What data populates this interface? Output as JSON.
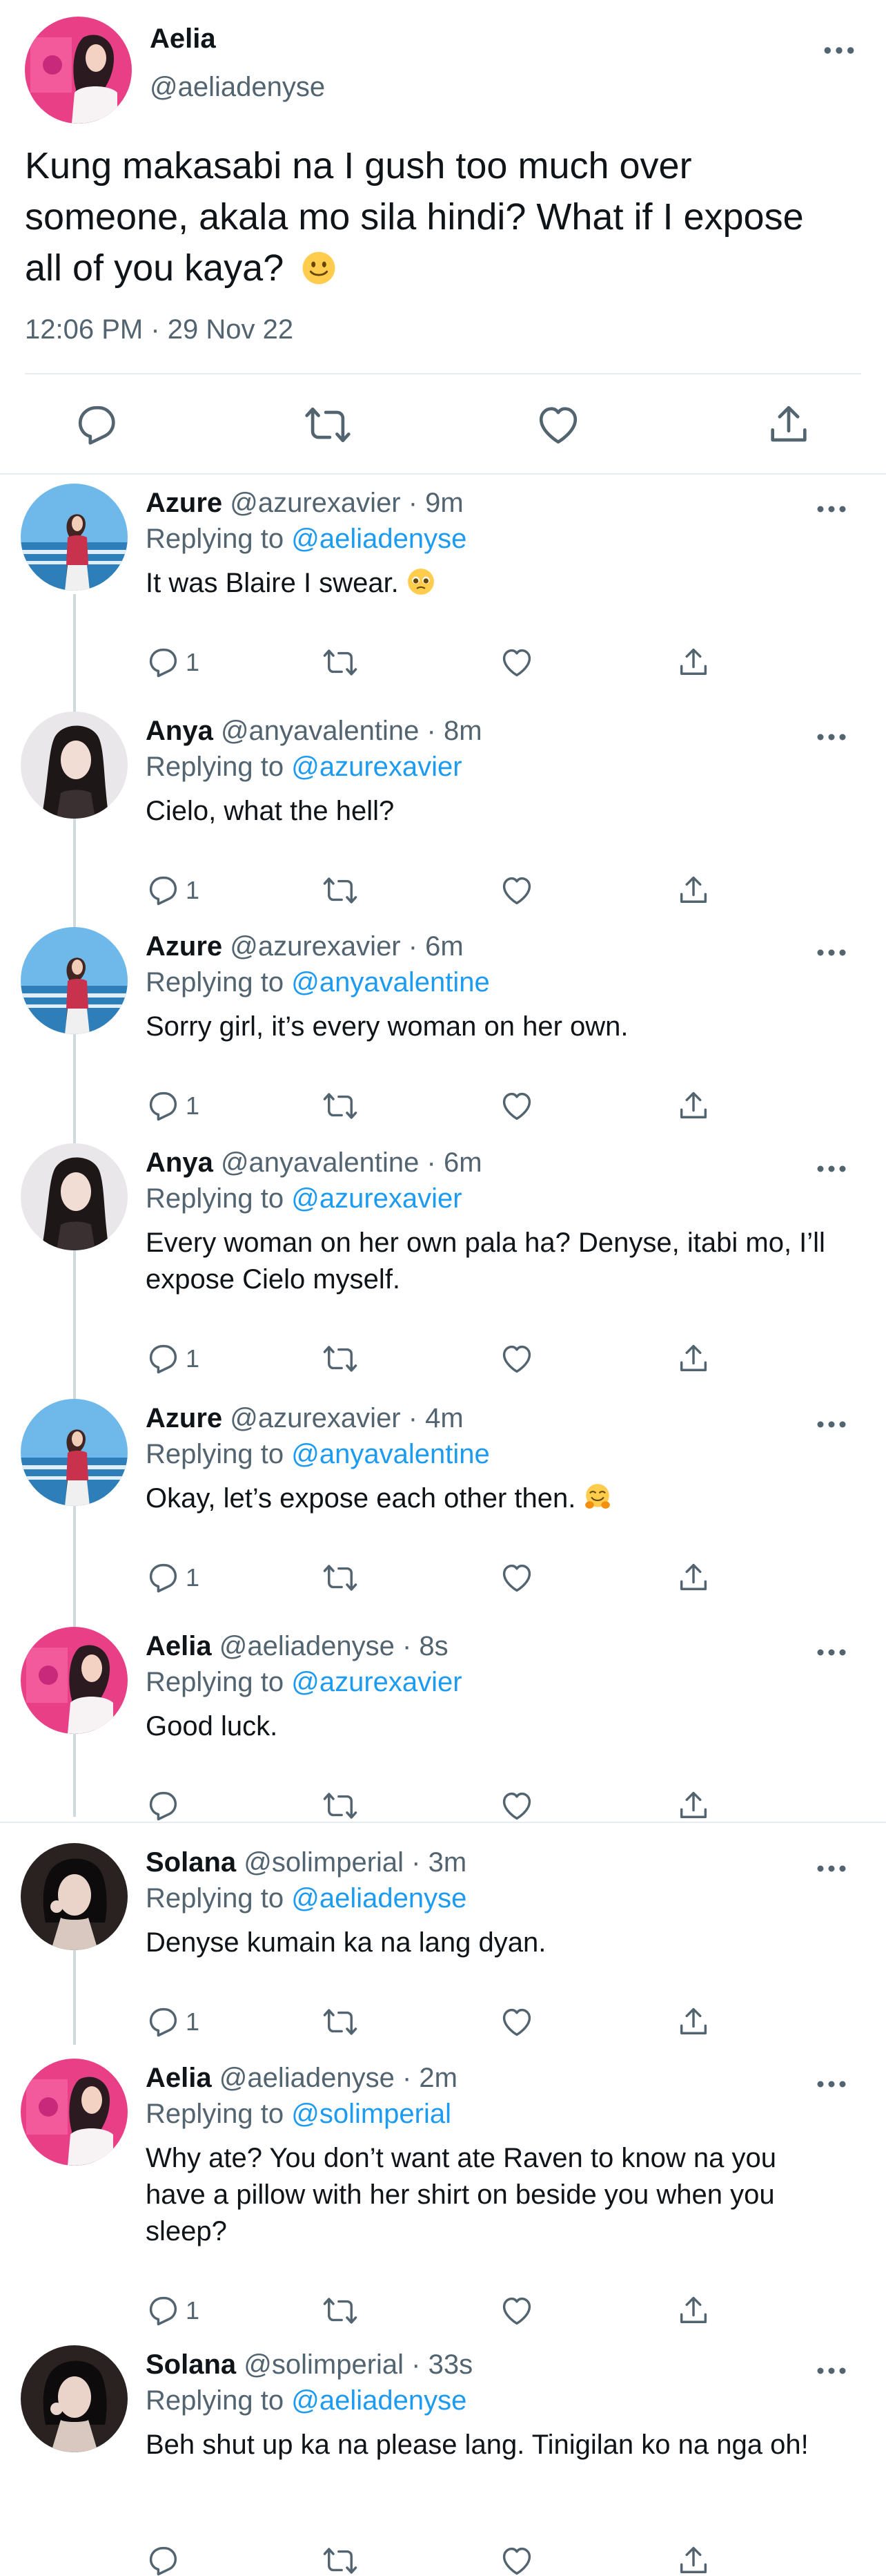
{
  "main_tweet": {
    "name": "Aelia",
    "handle": "@aeliadenyse",
    "text_l1": "Kung makasabi na I gush too much over",
    "text_l2": "someone, akala mo sila hindi? What if I expose",
    "text_l3": "all of you kaya?",
    "text_emoji": "slightly-smiling-face",
    "timestamp": "12:06 PM · 29 Nov 22"
  },
  "replies": [
    {
      "name": "Azure",
      "meta": "@azurexavier · 9m",
      "replying_prefix": "Replying to ",
      "replying_to": "@aeliadenyse",
      "text": "It was Blaire I swear.",
      "text_emoji": "pleading-face",
      "reply_count": "1",
      "avatar": "azure"
    },
    {
      "name": "Anya",
      "meta": "@anyavalentine · 8m",
      "replying_prefix": "Replying to ",
      "replying_to": "@azurexavier",
      "text": "Cielo, what the hell?",
      "reply_count": "1",
      "avatar": "anya"
    },
    {
      "name": "Azure",
      "meta": "@azurexavier · 6m",
      "replying_prefix": "Replying to ",
      "replying_to": "@anyavalentine",
      "text": "Sorry girl, it’s every woman on her own.",
      "reply_count": "1",
      "avatar": "azure"
    },
    {
      "name": "Anya",
      "meta": "@anyavalentine · 6m",
      "replying_prefix": "Replying to ",
      "replying_to": "@azurexavier",
      "text": "Every woman on her own pala ha? Denyse, itabi mo, I’ll expose Cielo myself.",
      "reply_count": "1",
      "avatar": "anya"
    },
    {
      "name": "Azure",
      "meta": "@azurexavier · 4m",
      "replying_prefix": "Replying to ",
      "replying_to": "@anyavalentine",
      "text": "Okay, let’s expose each other then.",
      "text_emoji": "hugging-face",
      "reply_count": "1",
      "avatar": "azure"
    },
    {
      "name": "Aelia",
      "meta": "@aeliadenyse · 8s",
      "replying_prefix": "Replying to ",
      "replying_to": "@azurexavier",
      "text": "Good luck.",
      "reply_count": "",
      "avatar": "aelia"
    },
    {
      "name": "Solana",
      "meta": "@solimperial · 3m",
      "replying_prefix": "Replying to ",
      "replying_to": "@aeliadenyse",
      "text": "Denyse kumain ka na lang dyan.",
      "reply_count": "1",
      "avatar": "solana"
    },
    {
      "name": "Aelia",
      "meta": "@aeliadenyse · 2m",
      "replying_prefix": "Replying to ",
      "replying_to": "@solimperial",
      "text": "Why ate? You don’t want ate Raven to know na you have a pillow with her shirt on beside you when you sleep?",
      "reply_count": "1",
      "avatar": "aelia"
    },
    {
      "name": "Solana",
      "meta": "@solimperial · 33s",
      "replying_prefix": "Replying to ",
      "replying_to": "@aeliadenyse",
      "text": "Beh shut up ka na please lang. Tinigilan ko na nga oh!",
      "reply_count": "",
      "avatar": "solana"
    }
  ],
  "icons": {
    "reply": "reply-icon",
    "retweet": "retweet-icon",
    "like": "like-icon",
    "share": "share-icon",
    "more": "more-icon"
  },
  "colors": {
    "link": "#1d9bf0",
    "secondary_text": "#536471",
    "divider": "#e6ecf0"
  }
}
